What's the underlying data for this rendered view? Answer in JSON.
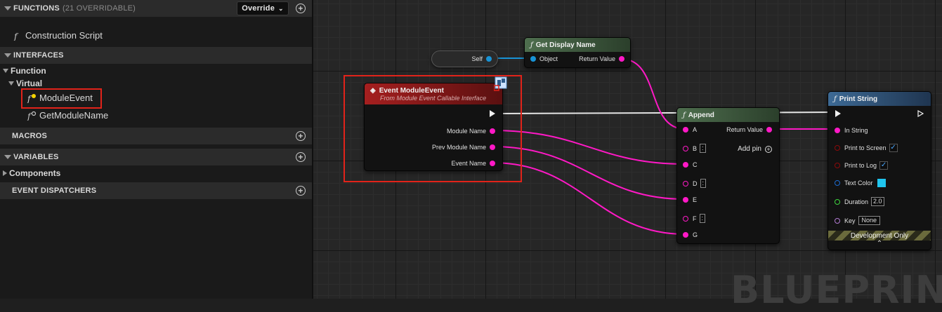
{
  "sidebar": {
    "functions": {
      "title": "FUNCTIONS",
      "count_label": "(21 OVERRIDABLE)",
      "override_button": "Override",
      "items": [
        {
          "label": "Construction Script"
        }
      ]
    },
    "interfaces": {
      "title": "INTERFACES",
      "group": "Function",
      "subgroup": "Virtual",
      "items": [
        {
          "label": "ModuleEvent"
        },
        {
          "label": "GetModuleName"
        }
      ]
    },
    "macros": {
      "title": "MACROS"
    },
    "variables": {
      "title": "VARIABLES",
      "group": "Components"
    },
    "dispatchers": {
      "title": "EVENT DISPATCHERS"
    }
  },
  "graph": {
    "self_node": {
      "label": "Self"
    },
    "get_display_name": {
      "title": "Get Display Name",
      "in_pin": "Object",
      "out_pin": "Return Value"
    },
    "event_node": {
      "title": "Event ModuleEvent",
      "subtitle": "From Module Event Callable Interface",
      "pins": [
        "Module Name",
        "Prev Module Name",
        "Event Name"
      ]
    },
    "append": {
      "title": "Append",
      "pins": [
        "A",
        "B",
        "C",
        "D",
        "E",
        "F",
        "G"
      ],
      "return_label": "Return Value",
      "add_pin": "Add pin"
    },
    "print_string": {
      "title": "Print String",
      "in_string": "In String",
      "print_to_screen": "Print to Screen",
      "print_to_log": "Print to Log",
      "text_color": "Text Color",
      "duration": "Duration",
      "duration_value": "2.0",
      "key": "Key",
      "key_value": "None",
      "dev_only": "Development Only"
    },
    "watermark": "BLUEPRINT"
  },
  "colors": {
    "accent_red": "#e2231a",
    "string_pin": "#ff19c6",
    "object_pin": "#1893d6",
    "event_header": "#8f1919",
    "function_header": "#3c5a3c",
    "print_header": "#2f4d6b"
  }
}
